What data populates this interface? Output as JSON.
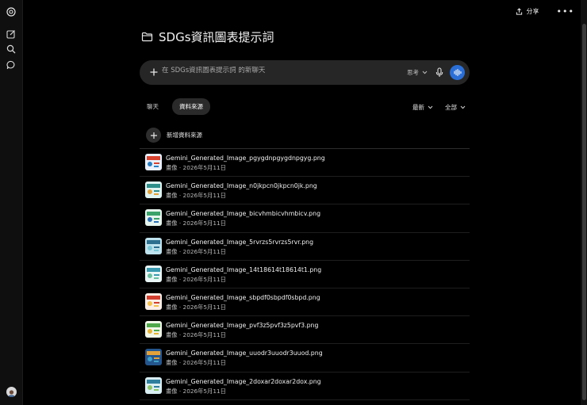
{
  "header": {
    "share_label": "分享",
    "more_label": "•••"
  },
  "project": {
    "title": "SDGs資訊圖表提示詞"
  },
  "composer": {
    "placeholder": "在 SDGs資訊圖表提示詞 的新聊天",
    "think_label": "思考"
  },
  "tabs": [
    {
      "label": "聊天",
      "active": false
    },
    {
      "label": "資料來源",
      "active": true
    }
  ],
  "sort_label": "最新",
  "filter_label": "全部",
  "add_source_label": "新增資料來源",
  "files": [
    {
      "name": "Gemini_Generated_Image_pgygdnpgygdnpgyg.png",
      "meta": "畫像 · 2026年5月11日",
      "thumb_colors": [
        "#e9f0ff",
        "#d8432f",
        "#2a7fc1"
      ]
    },
    {
      "name": "Gemini_Generated_Image_n0jkpcn0jkpcn0jk.png",
      "meta": "畫像 · 2026年5月11日",
      "thumb_colors": [
        "#dff3f0",
        "#2e8f8a",
        "#e2a23b"
      ]
    },
    {
      "name": "Gemini_Generated_Image_bicvhmbicvhmbicv.png",
      "meta": "畫像 · 2026年5月11日",
      "thumb_colors": [
        "#e5f5ee",
        "#3aa36b",
        "#2d6fb3"
      ]
    },
    {
      "name": "Gemini_Generated_Image_5rvrzs5rvrzs5rvr.png",
      "meta": "畫像 · 2026年5月11日",
      "thumb_colors": [
        "#bfe3ee",
        "#2c6f8f",
        "#7cc7d6"
      ]
    },
    {
      "name": "Gemini_Generated_Image_14t18614t18614t1.png",
      "meta": "畫像 · 2026年5月11日",
      "thumb_colors": [
        "#eaf6f6",
        "#3a9bb0",
        "#6cc0a0"
      ]
    },
    {
      "name": "Gemini_Generated_Image_sbpdf0sbpdf0sbpd.png",
      "meta": "畫像 · 2026年5月11日",
      "thumb_colors": [
        "#fbeee6",
        "#d23f2f",
        "#f2c14e"
      ]
    },
    {
      "name": "Gemini_Generated_Image_pvf3z5pvf3z5pvf3.png",
      "meta": "畫像 · 2026年5月11日",
      "thumb_colors": [
        "#f0f7e9",
        "#4fa84a",
        "#e7b43a"
      ]
    },
    {
      "name": "Gemini_Generated_Image_uuodr3uuodr3uuod.png",
      "meta": "畫像 · 2026年5月11日",
      "thumb_colors": [
        "#24558c",
        "#e3a13b",
        "#3fa0c8"
      ]
    },
    {
      "name": "Gemini_Generated_Image_2doxar2doxar2dox.png",
      "meta": "畫像 · 2026年5月11日",
      "thumb_colors": [
        "#d9eef2",
        "#2f7f9e",
        "#8cc46a"
      ]
    }
  ],
  "colors": {
    "background": "#000000",
    "composer": "#262626",
    "accent": "#2b6fd6"
  }
}
